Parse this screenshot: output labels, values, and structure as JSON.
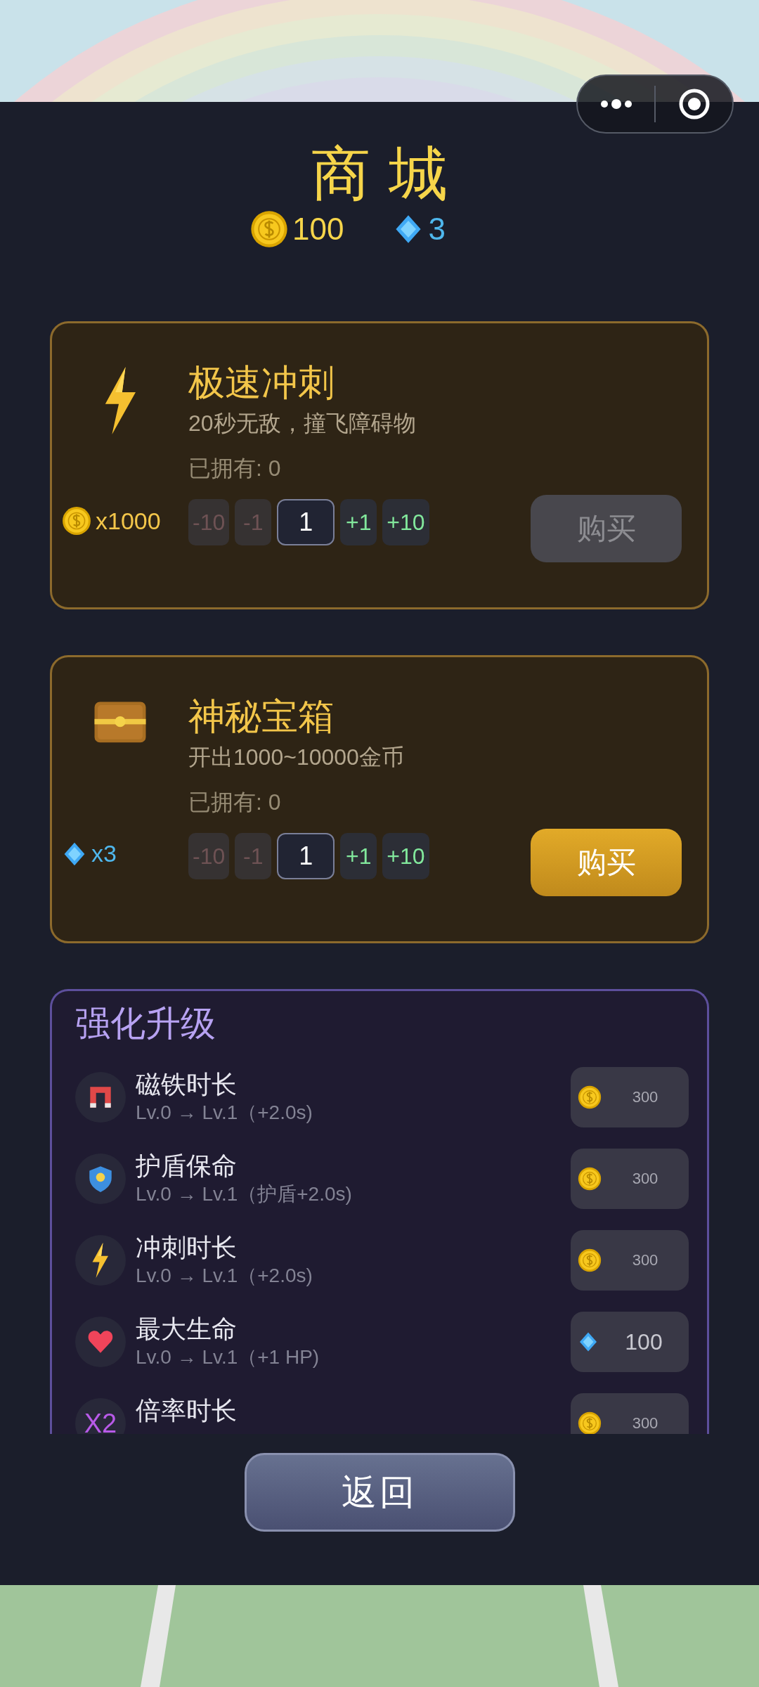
{
  "title": "商城",
  "wallet": [
    {
      "kind": "coin",
      "amount": "100"
    },
    {
      "kind": "gem",
      "amount": "3"
    }
  ],
  "items": [
    {
      "kind": "bolt",
      "name": "极速冲刺",
      "description": "20秒无敌，撞飞障碍物",
      "owned": "已拥有: 0",
      "price": {
        "kind": "coin",
        "amount": "x1000"
      },
      "stepper": [
        {
          "kind": "button",
          "label": "-10",
          "disabled": true
        },
        {
          "kind": "button",
          "label": "-1",
          "disabled": true
        },
        {
          "kind": "field",
          "value": "1"
        },
        {
          "kind": "button",
          "label": "+1",
          "disabled": false
        },
        {
          "kind": "button",
          "label": "+10",
          "disabled": false
        }
      ],
      "buy": {
        "label": "购买",
        "disabled": true
      }
    },
    {
      "kind": "chest",
      "name": "神秘宝箱",
      "description": "开出1000~10000金币",
      "owned": "已拥有: 0",
      "price": {
        "kind": "gem",
        "amount": "x3"
      },
      "stepper": [
        {
          "kind": "button",
          "label": "-10",
          "disabled": true
        },
        {
          "kind": "button",
          "label": "-1",
          "disabled": true
        },
        {
          "kind": "field",
          "value": "1"
        },
        {
          "kind": "button",
          "label": "+1",
          "disabled": false
        },
        {
          "kind": "button",
          "label": "+10",
          "disabled": false
        }
      ],
      "buy": {
        "label": "购买",
        "disabled": false
      }
    }
  ],
  "upgrades": {
    "title": "强化升级",
    "rows": [
      {
        "kind": "magnet",
        "name": "磁铁时长",
        "detail": "Lv.0 → Lv.1（+2.0s)",
        "cost": {
          "kind": "coin",
          "amount": "300"
        }
      },
      {
        "kind": "shield",
        "name": "护盾保命",
        "detail": "Lv.0 → Lv.1（护盾+2.0s)",
        "cost": {
          "kind": "coin",
          "amount": "300"
        }
      },
      {
        "kind": "bolt",
        "name": "冲刺时长",
        "detail": "Lv.0 → Lv.1（+2.0s)",
        "cost": {
          "kind": "coin",
          "amount": "300"
        }
      },
      {
        "kind": "heart",
        "name": "最大生命",
        "detail": "Lv.0 → Lv.1（+1 HP)",
        "cost": {
          "kind": "gem",
          "amount": "100"
        }
      },
      {
        "kind": "text",
        "badge": "X2",
        "name": "倍率时长",
        "cost": {
          "kind": "coin",
          "amount": "300"
        }
      }
    ]
  },
  "back": "返回"
}
